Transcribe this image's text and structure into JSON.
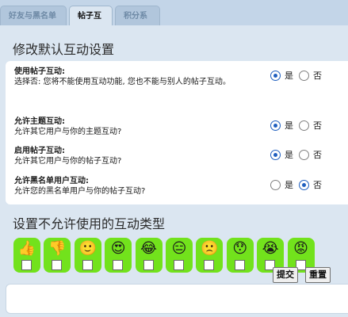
{
  "tabs": [
    {
      "label": "好友与黑名单",
      "active": false
    },
    {
      "label": "帖子互动",
      "active": true
    },
    {
      "label": "积分系统",
      "active": false
    }
  ],
  "section1": {
    "title": "修改默认互动设置",
    "yes_label": "是",
    "no_label": "否",
    "rows": [
      {
        "label": "使用帖子互动:",
        "desc": "选择否: 您将不能使用互动功能, 您也不能与别人的帖子互动。",
        "value": "是"
      },
      {
        "label": "允许主题互动:",
        "desc": "允许其它用户与你的主题互动?",
        "value": "是"
      },
      {
        "label": "启用帖子互动:",
        "desc": "允许其它用户与你的帖子互动?",
        "value": "是"
      },
      {
        "label": "允许黑名单用户互动:",
        "desc": "允许您的黑名单用户与你的帖子互动?",
        "value": "否"
      }
    ]
  },
  "section2": {
    "title": "设置不允许使用的互动类型",
    "emojis": [
      {
        "icon": "thumbs-up-icon",
        "glyph": "👍"
      },
      {
        "icon": "thumbs-down-icon",
        "glyph": "👎"
      },
      {
        "icon": "smile-icon",
        "glyph": "🙂"
      },
      {
        "icon": "heart-eyes-icon",
        "glyph": "😍"
      },
      {
        "icon": "laughing-tears-icon",
        "glyph": "😂"
      },
      {
        "icon": "unamused-icon",
        "glyph": "😑"
      },
      {
        "icon": "sad-icon",
        "glyph": "🙁"
      },
      {
        "icon": "surprised-icon",
        "glyph": "😯"
      },
      {
        "icon": "crying-icon",
        "glyph": "😭"
      },
      {
        "icon": "angry-icon",
        "glyph": "😡"
      }
    ]
  },
  "buttons": {
    "submit": "提交",
    "reset": "重置"
  },
  "colors": {
    "background": "#c3d5e8",
    "frame": "#dbe6f1",
    "emoji_tile": "#72e21c",
    "radio_checked": "#1f5fbf"
  }
}
